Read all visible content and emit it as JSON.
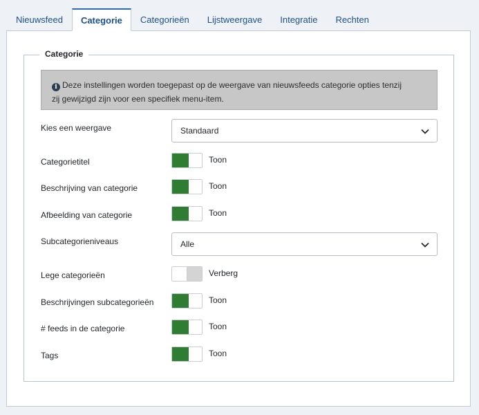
{
  "tabs": [
    {
      "label": "Nieuwsfeed",
      "active": false
    },
    {
      "label": "Categorie",
      "active": true
    },
    {
      "label": "Categorieën",
      "active": false
    },
    {
      "label": "Lijstweergave",
      "active": false
    },
    {
      "label": "Integratie",
      "active": false
    },
    {
      "label": "Rechten",
      "active": false
    }
  ],
  "fieldset": {
    "legend": "Categorie",
    "alert_line1": "Deze instellingen worden toegepast op de weergave van nieuwsfeeds categorie opties tenzij",
    "alert_line2": "zij gewijzigd zijn voor een specifiek menu-item.",
    "alert_icon": "info-circle-icon"
  },
  "fields": {
    "layout": {
      "label": "Kies een weergave",
      "value": "Standaard"
    },
    "category_title": {
      "label": "Categorietitel",
      "state": "Toon",
      "on": true
    },
    "category_description": {
      "label": "Beschrijving van categorie",
      "state": "Toon",
      "on": true
    },
    "category_image": {
      "label": "Afbeelding van categorie",
      "state": "Toon",
      "on": true
    },
    "subcategory_levels": {
      "label": "Subcategorieniveaus",
      "value": "Alle"
    },
    "empty_categories": {
      "label": "Lege categorieën",
      "state": "Verberg",
      "on": false
    },
    "subcategory_descriptions": {
      "label": "Beschrijvingen subcategorieën",
      "state": "Toon",
      "on": true
    },
    "feeds_in_category": {
      "label": "# feeds in de categorie",
      "state": "Toon",
      "on": true
    },
    "tags": {
      "label": "Tags",
      "state": "Toon",
      "on": true
    }
  },
  "colors": {
    "switch_on": "#2e7d32",
    "tab_active_border": "#2a6bb3",
    "link": "#1b4f8c",
    "alert_bg": "#c7c7c7"
  }
}
